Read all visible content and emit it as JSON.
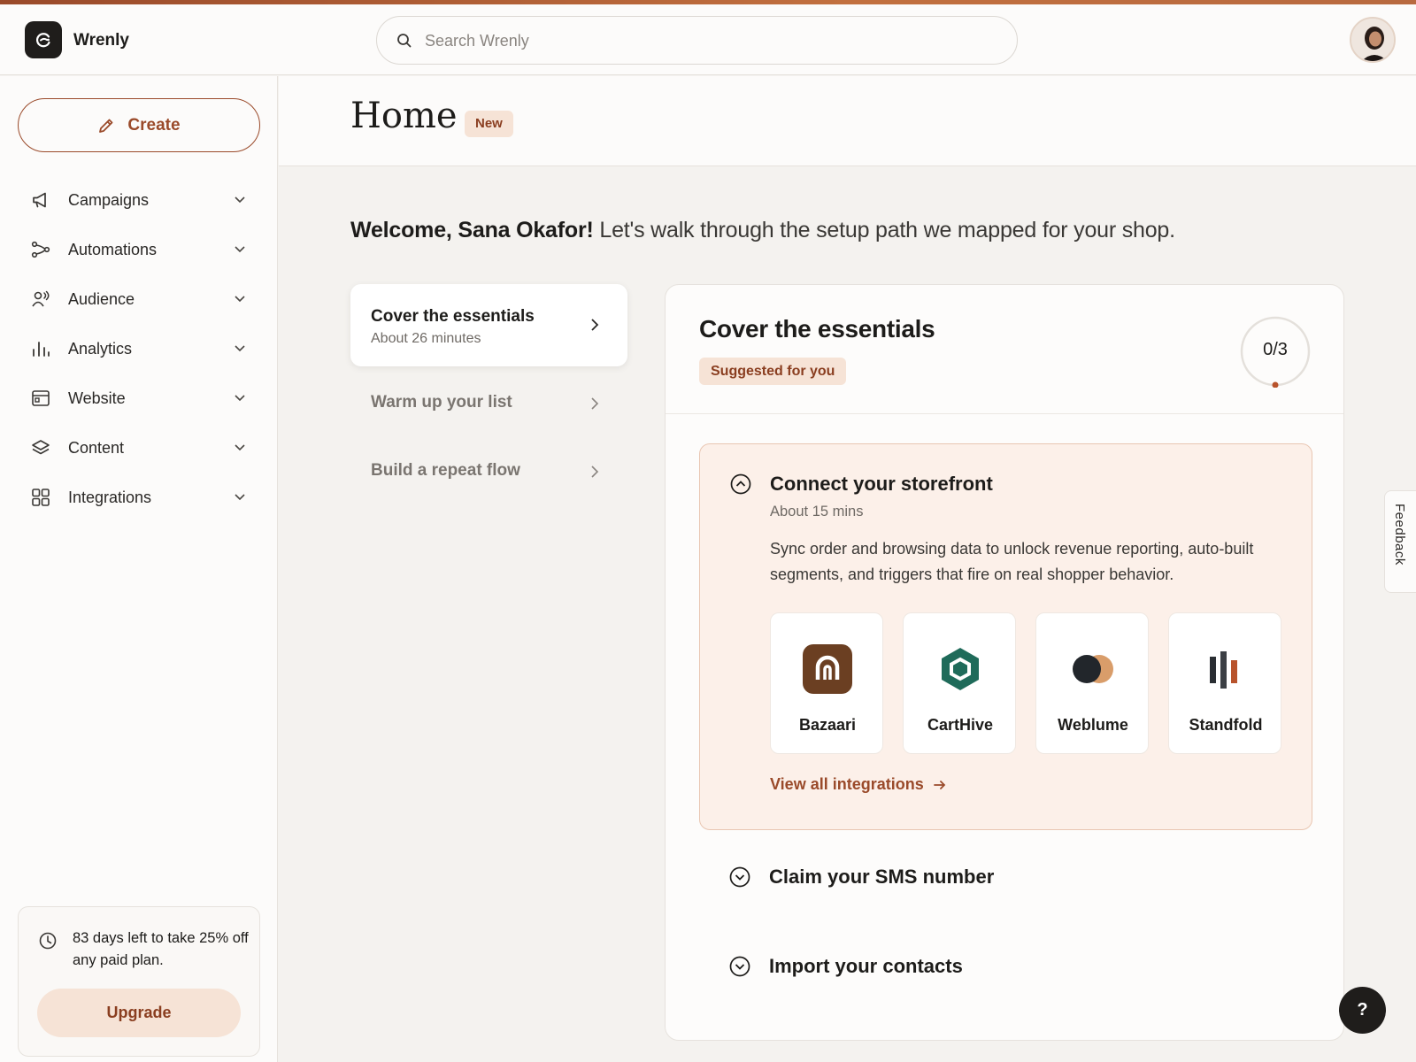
{
  "app": {
    "name": "Wrenly"
  },
  "search": {
    "placeholder": "Search Wrenly"
  },
  "sidebar": {
    "create_label": "Create",
    "items": [
      {
        "label": "Campaigns",
        "icon": "megaphone-icon"
      },
      {
        "label": "Automations",
        "icon": "flow-icon"
      },
      {
        "label": "Audience",
        "icon": "audience-icon"
      },
      {
        "label": "Analytics",
        "icon": "bar-chart-icon"
      },
      {
        "label": "Website",
        "icon": "browser-window-icon"
      },
      {
        "label": "Content",
        "icon": "layers-icon"
      },
      {
        "label": "Integrations",
        "icon": "grid-icon"
      }
    ],
    "promo": {
      "text": "83 days left to take 25% off any paid plan.",
      "button": "Upgrade"
    }
  },
  "page": {
    "title": "Home",
    "badge": "New"
  },
  "welcome": {
    "name": "Welcome, Sana Okafor!",
    "rest": "Let's walk through the setup path we mapped for your shop."
  },
  "steps": [
    {
      "title": "Cover the essentials",
      "subtitle": "About 26 minutes",
      "active": true
    },
    {
      "title": "Warm up your list"
    },
    {
      "title": "Build a repeat flow"
    }
  ],
  "essentials": {
    "title": "Cover the essentials",
    "badge": "Suggested for you",
    "progress": "0/3",
    "tasks": [
      {
        "title": "Connect your storefront",
        "time": "About 15 mins",
        "description": "Sync order and browsing data to unlock revenue reporting, auto-built segments, and triggers that fire on real shopper behavior.",
        "integrations": [
          {
            "name": "Bazaari"
          },
          {
            "name": "CartHive"
          },
          {
            "name": "Weblume"
          },
          {
            "name": "Standfold"
          }
        ],
        "link": "View all integrations"
      },
      {
        "title": "Claim your SMS number"
      },
      {
        "title": "Import your contacts"
      }
    ]
  },
  "feedback": {
    "label": "Feedback"
  },
  "help": {
    "label": "?"
  },
  "colors": {
    "accent": "#9a4a2a",
    "badge_bg": "#f6e3d6",
    "panel_bg": "#fcf0e9"
  }
}
